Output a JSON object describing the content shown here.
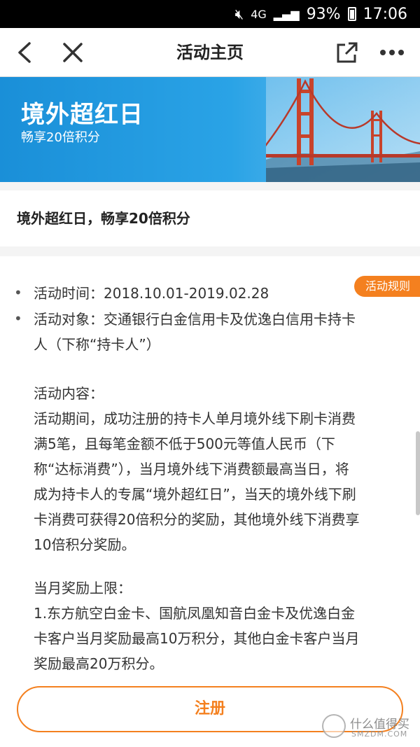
{
  "status_bar": {
    "network": "4G",
    "battery": "93%",
    "time": "17:06"
  },
  "nav": {
    "title": "活动主页",
    "icons": [
      "back-arrow-icon",
      "close-icon",
      "share-icon",
      "more-icon"
    ]
  },
  "banner": {
    "title": "境外超红日",
    "subtitle": "畅享20倍积分"
  },
  "headline": "境外超红日，畅享20倍积分",
  "rules_badge": "活动规则",
  "content": {
    "bullets": [
      {
        "lines": [
          "活动时间：2018.10.01-2019.02.28"
        ]
      },
      {
        "lines": [
          "活动对象：交通银行白金信用卡及优逸白信用卡持卡",
          "人（下称“持卡人”）"
        ]
      }
    ],
    "section1": {
      "heading": "活动内容：",
      "lines": [
        "活动期间，成功注册的持卡人单月境外线下刷卡消费",
        "满5笔，且每笔金额不低于500元等值人民币（下",
        "称“达标消费”），当月境外线下消费额最高当日，将",
        "成为持卡人的专属“境外超红日”，当天的境外线下刷",
        "卡消费可获得20倍积分的奖励，其他境外线下消费享",
        "10倍积分奖励。"
      ]
    },
    "section2": {
      "heading": "当月奖励上限：",
      "lines": [
        "1.东方航空白金卡、国航凤凰知音白金卡及优逸白金",
        "卡客户当月奖励最高10万积分，其他白金卡客户当月",
        "奖励最高20万积分。"
      ]
    }
  },
  "register_button": "注册",
  "watermark": {
    "text": "什么值得买",
    "sub": "SMZDM.COM"
  },
  "colors": {
    "accent": "#f4801f",
    "banner_blue": "#1a8fd8",
    "status_bar": "#000000"
  }
}
